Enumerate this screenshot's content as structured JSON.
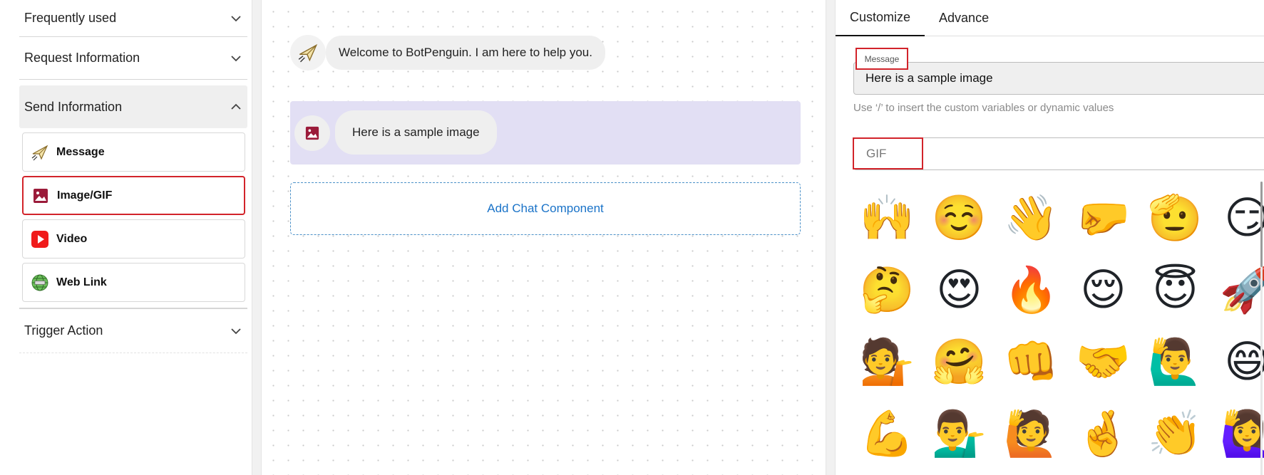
{
  "sidebar": {
    "sections": {
      "frequently_used": "Frequently used",
      "request_information": "Request Information",
      "send_information": "Send Information",
      "trigger_action": "Trigger Action"
    },
    "items": [
      {
        "label": "Message",
        "icon": "paper-plane-icon"
      },
      {
        "label": "Image/GIF",
        "icon": "image-icon"
      },
      {
        "label": "Video",
        "icon": "video-play-icon"
      },
      {
        "label": "Web Link",
        "icon": "globe-icon"
      }
    ],
    "selected_item": "Image/GIF"
  },
  "canvas": {
    "welcome_message": "Welcome to BotPenguin. I am here to help you.",
    "image_message": "Here is a sample image",
    "add_component": "Add Chat Component"
  },
  "panel": {
    "tabs": [
      "Customize",
      "Advance"
    ],
    "active_tab": "Customize",
    "message_label": "Message",
    "message_value": "Here is a sample image",
    "hint": "Use ‘/’ to insert the custom variables or dynamic values",
    "gif_label": "GIF",
    "emojis": [
      "🙌",
      "☺️",
      "👋",
      "🤛",
      "🫡",
      "😏",
      "🤔",
      "😍",
      "🔥",
      "😌",
      "😇",
      "🚀",
      "💁",
      "🤗",
      "👊",
      "🤝",
      "🙋‍♂️",
      "😄",
      "💪",
      "💁‍♂️",
      "🙋",
      "🤞",
      "👏",
      "🙋‍♀️"
    ]
  },
  "colors": {
    "accent_blue": "#1a73c8",
    "highlight_red": "#d2232a",
    "selected_block": "#e2dff4"
  }
}
